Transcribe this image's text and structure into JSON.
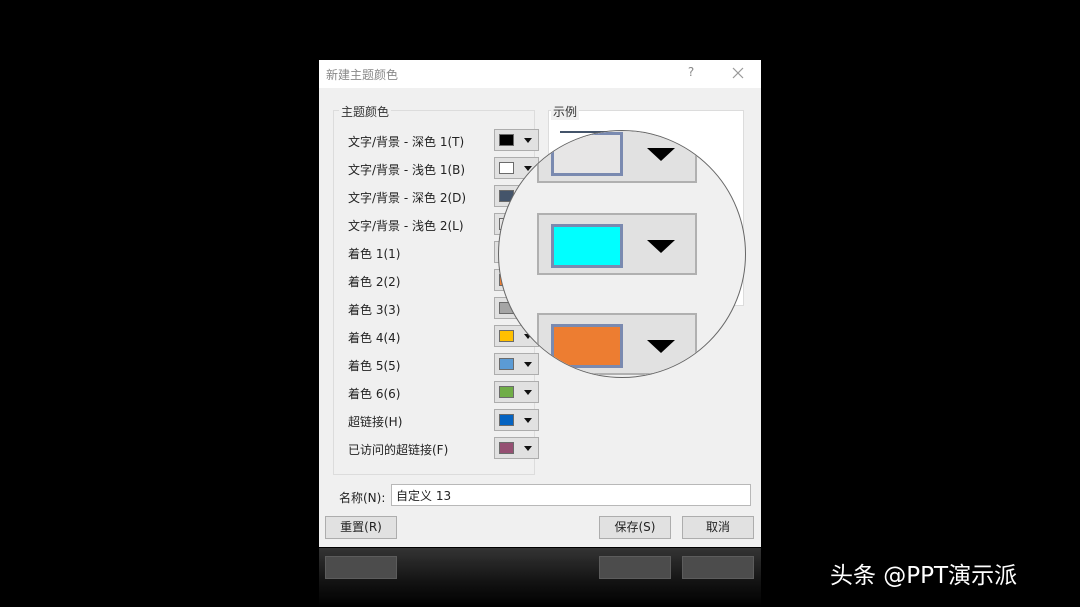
{
  "dialog": {
    "title": "新建主题颜色",
    "help": "?",
    "close": "×"
  },
  "theme_colors": {
    "group_label": "主题颜色",
    "rows": [
      {
        "label": "文字/背景 - 深色 1(T)",
        "color": "#000000"
      },
      {
        "label": "文字/背景 - 浅色 1(B)",
        "color": "#ffffff"
      },
      {
        "label": "文字/背景 - 深色 2(D)",
        "color": "#44546a"
      },
      {
        "label": "文字/背景 - 浅色 2(L)",
        "color": "#e7e6e6"
      },
      {
        "label": "着色 1(1)",
        "color": "#00ffff"
      },
      {
        "label": "着色 2(2)",
        "color": "#ed7d31"
      },
      {
        "label": "着色 3(3)",
        "color": "#a5a5a5"
      },
      {
        "label": "着色 4(4)",
        "color": "#ffc000"
      },
      {
        "label": "着色 5(5)",
        "color": "#5b9bd5"
      },
      {
        "label": "着色 6(6)",
        "color": "#70ad47"
      },
      {
        "label": "超链接(H)",
        "color": "#0563c1"
      },
      {
        "label": "已访问的超链接(F)",
        "color": "#954f72"
      }
    ]
  },
  "preview": {
    "group_label": "示例"
  },
  "name_field": {
    "label": "名称(N):",
    "value": "自定义 13"
  },
  "buttons": {
    "reset": "重置(R)",
    "save": "保存(S)",
    "cancel": "取消"
  },
  "watermark": "头条 @PPT演示派"
}
